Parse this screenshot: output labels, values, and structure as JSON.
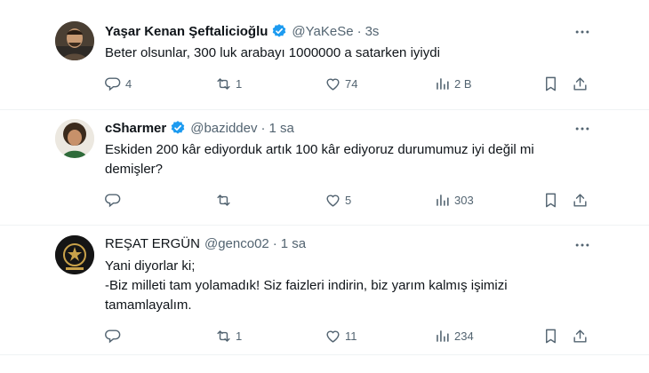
{
  "tweets": [
    {
      "name": "Yaşar Kenan Şeftalicioğlu",
      "handle": "@YaKeSe",
      "time": "3s",
      "text": "Beter olsunlar, 300 luk arabayı 1000000 a satarken iyiydi",
      "replies": "4",
      "retweets": "1",
      "likes": "74",
      "views": "2 B"
    },
    {
      "name": "cSharmer",
      "handle": "@baziddev",
      "time": "1 sa",
      "text": "Eskiden 200 kâr ediyorduk artık 100 kâr ediyoruz durumumuz iyi değil mi\ndemişler?",
      "replies": "",
      "retweets": "",
      "likes": "5",
      "views": "303"
    },
    {
      "name": "REŞAT ERGÜN",
      "handle": "@genco02",
      "time": "1 sa",
      "text": "Yani diyorlar ki;\n-Biz milleti tam yolamadık! Siz faizleri indirin, biz yarım kalmış işimizi\ntamamlayalım.",
      "replies": "",
      "retweets": "1",
      "likes": "11",
      "views": "234"
    }
  ],
  "separator": "·",
  "colors": {
    "verified": "#1d9bf0",
    "secondary": "#536471",
    "text": "#0f1419"
  },
  "icons": [
    "more-icon",
    "reply-icon",
    "retweet-icon",
    "like-icon",
    "views-icon",
    "bookmark-icon",
    "share-icon",
    "verified-badge-icon"
  ]
}
